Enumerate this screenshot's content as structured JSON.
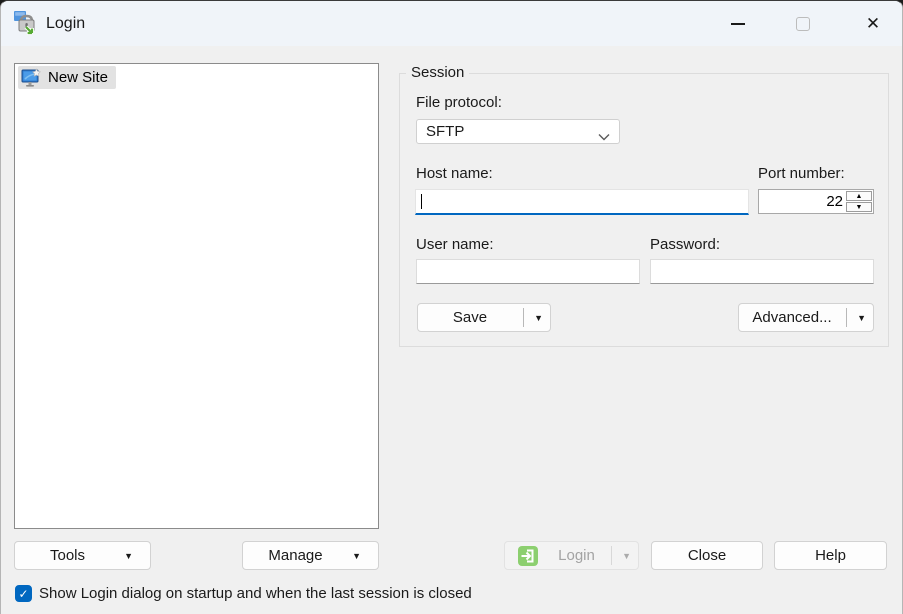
{
  "window": {
    "title": "Login"
  },
  "icons": {
    "dropdown_arrow": "▼",
    "spinner_up": "▲",
    "spinner_down": "▼",
    "check": "✓",
    "close": "✕"
  },
  "site_list": {
    "items": [
      {
        "label": "New Site",
        "selected": true
      }
    ]
  },
  "session": {
    "group_label": "Session",
    "file_protocol_label": "File protocol:",
    "file_protocol_value": "SFTP",
    "host_label": "Host name:",
    "host_value": "",
    "port_label": "Port number:",
    "port_value": "22",
    "user_label": "User name:",
    "user_value": "",
    "password_label": "Password:",
    "password_value": "",
    "save_label": "Save",
    "advanced_label": "Advanced..."
  },
  "footer": {
    "tools_label": "Tools",
    "manage_label": "Manage",
    "login_label": "Login",
    "close_label": "Close",
    "help_label": "Help",
    "checkbox_label": "Show Login dialog on startup and when the last session is closed",
    "checkbox_checked": true
  },
  "colors": {
    "accent_blue": "#0067c0",
    "login_icon_green": "#8ccf6f",
    "titlebar_bg": "#f0f4f9",
    "dialog_bg": "#f0f0f0"
  }
}
